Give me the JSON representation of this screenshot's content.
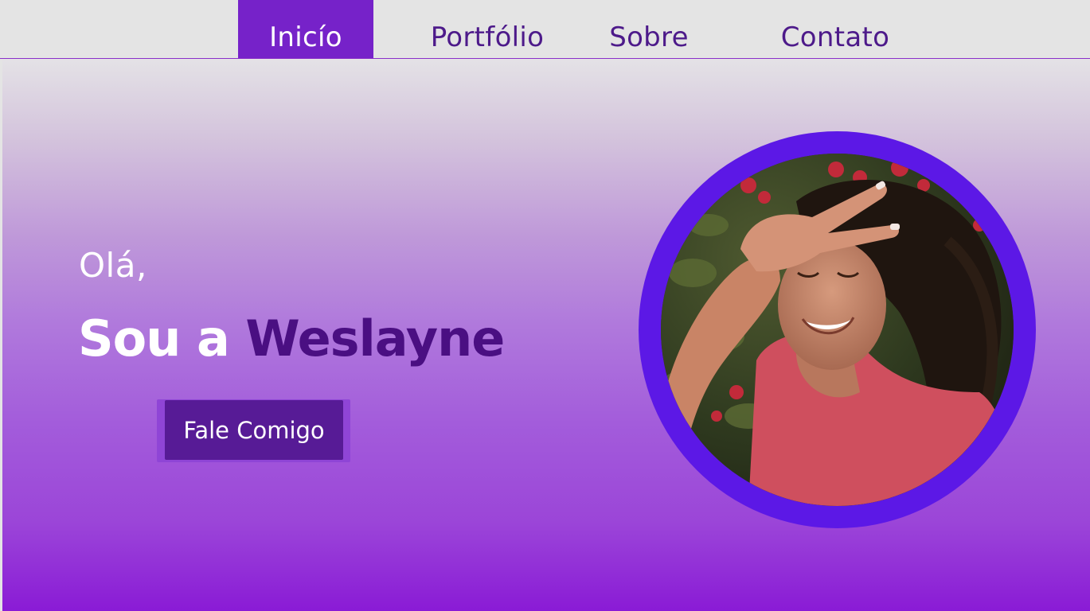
{
  "nav": {
    "items": [
      {
        "label": "Inicío",
        "active": true
      },
      {
        "label": "Portfólio",
        "active": false
      },
      {
        "label": "Sobre",
        "active": false
      },
      {
        "label": "Contato",
        "active": false
      }
    ]
  },
  "hero": {
    "greeting": "Olá,",
    "headline_prefix": "Sou a ",
    "headline_name": "Weslayne",
    "cta_label": "Fale Comigo"
  },
  "colors": {
    "accent": "#7622c9",
    "name_color": "#4a0f82",
    "ring": "#5c18e6",
    "button": "#571b96"
  }
}
